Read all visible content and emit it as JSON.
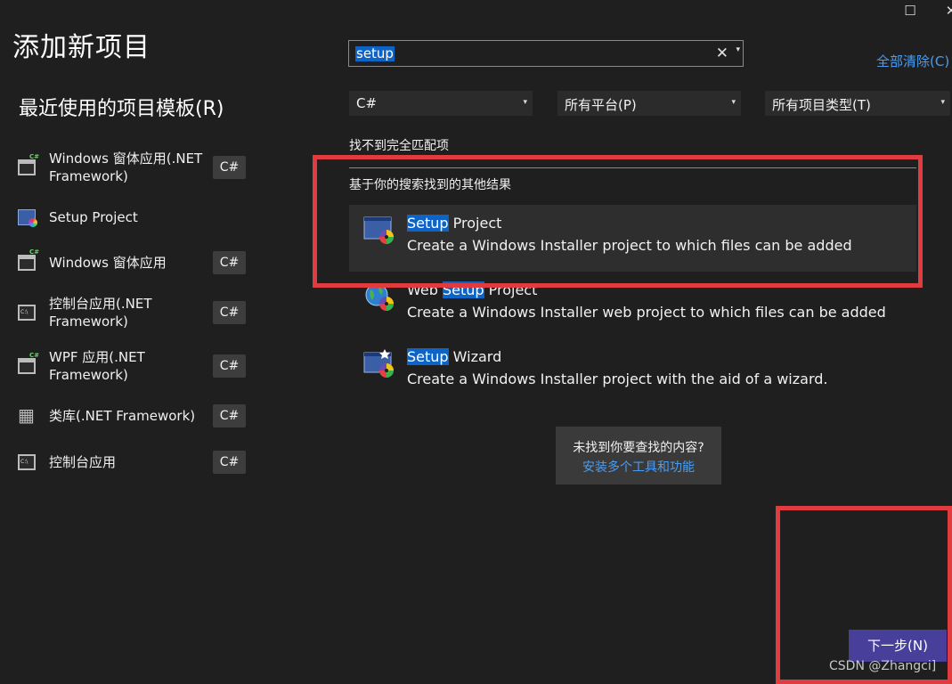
{
  "window": {
    "maximize_glyph": "☐",
    "close_glyph": "✕"
  },
  "title": "添加新项目",
  "recent": {
    "header": "最近使用的项目模板(R)",
    "items": [
      {
        "label": "Windows 窗体应用(.NET Framework)",
        "badge": "C#",
        "icon": "windows-form-icon"
      },
      {
        "label": "Setup Project",
        "badge": "",
        "icon": "setup-project-icon"
      },
      {
        "label": "Windows 窗体应用",
        "badge": "C#",
        "icon": "windows-form-icon"
      },
      {
        "label": "控制台应用(.NET Framework)",
        "badge": "C#",
        "icon": "console-app-icon"
      },
      {
        "label": "WPF 应用(.NET Framework)",
        "badge": "C#",
        "icon": "wpf-app-icon"
      },
      {
        "label": "类库(.NET Framework)",
        "badge": "C#",
        "icon": "class-library-icon"
      },
      {
        "label": "控制台应用",
        "badge": "C#",
        "icon": "console-app-icon"
      }
    ]
  },
  "search": {
    "value": "setup",
    "clear_glyph": "✕",
    "dropdown_glyph": "▾"
  },
  "clear_all": "全部清除(C)",
  "filters": {
    "language": "C#",
    "platform": "所有平台(P)",
    "project_type": "所有项目类型(T)",
    "arrow": "▾"
  },
  "no_exact_match": "找不到完全匹配项",
  "other_results_header": "基于你的搜索找到的其他结果",
  "results": [
    {
      "title_pre": "",
      "title_hl": "Setup",
      "title_post": " Project",
      "description": "Create a Windows Installer project to which files can be added",
      "icon": "setup-project-icon",
      "selected": true
    },
    {
      "title_pre": "Web ",
      "title_hl": "Setup",
      "title_post": " Project",
      "description": "Create a Windows Installer web project to which files can be added",
      "icon": "web-setup-project-icon",
      "selected": false
    },
    {
      "title_pre": "",
      "title_hl": "Setup",
      "title_post": " Wizard",
      "description": "Create a Windows Installer project with the aid of a wizard.",
      "icon": "setup-wizard-icon",
      "selected": false
    }
  ],
  "help": {
    "question": "未找到你要查找的内容?",
    "link": "安装多个工具和功能"
  },
  "next_button": "下一步(N)",
  "watermark": "CSDN @Zhangci]",
  "colors": {
    "background": "#1f1f1f",
    "accent_link": "#4b9df1",
    "search_highlight": "#0e63c6",
    "primary_button": "#483f9b",
    "annotation_red": "#e03b3f"
  }
}
